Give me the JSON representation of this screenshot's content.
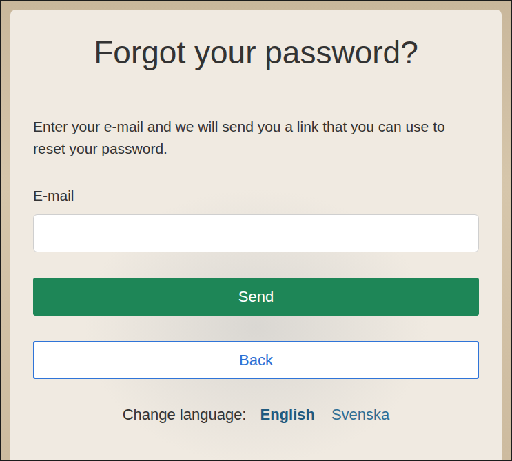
{
  "title": "Forgot your password?",
  "instructions": "Enter your e-mail and we will send you a link that you can use to reset your password.",
  "email_field": {
    "label": "E-mail",
    "value": ""
  },
  "buttons": {
    "send": "Send",
    "back": "Back"
  },
  "language": {
    "label": "Change language:",
    "options": [
      {
        "label": "English",
        "selected": true
      },
      {
        "label": "Svenska",
        "selected": false
      }
    ]
  }
}
